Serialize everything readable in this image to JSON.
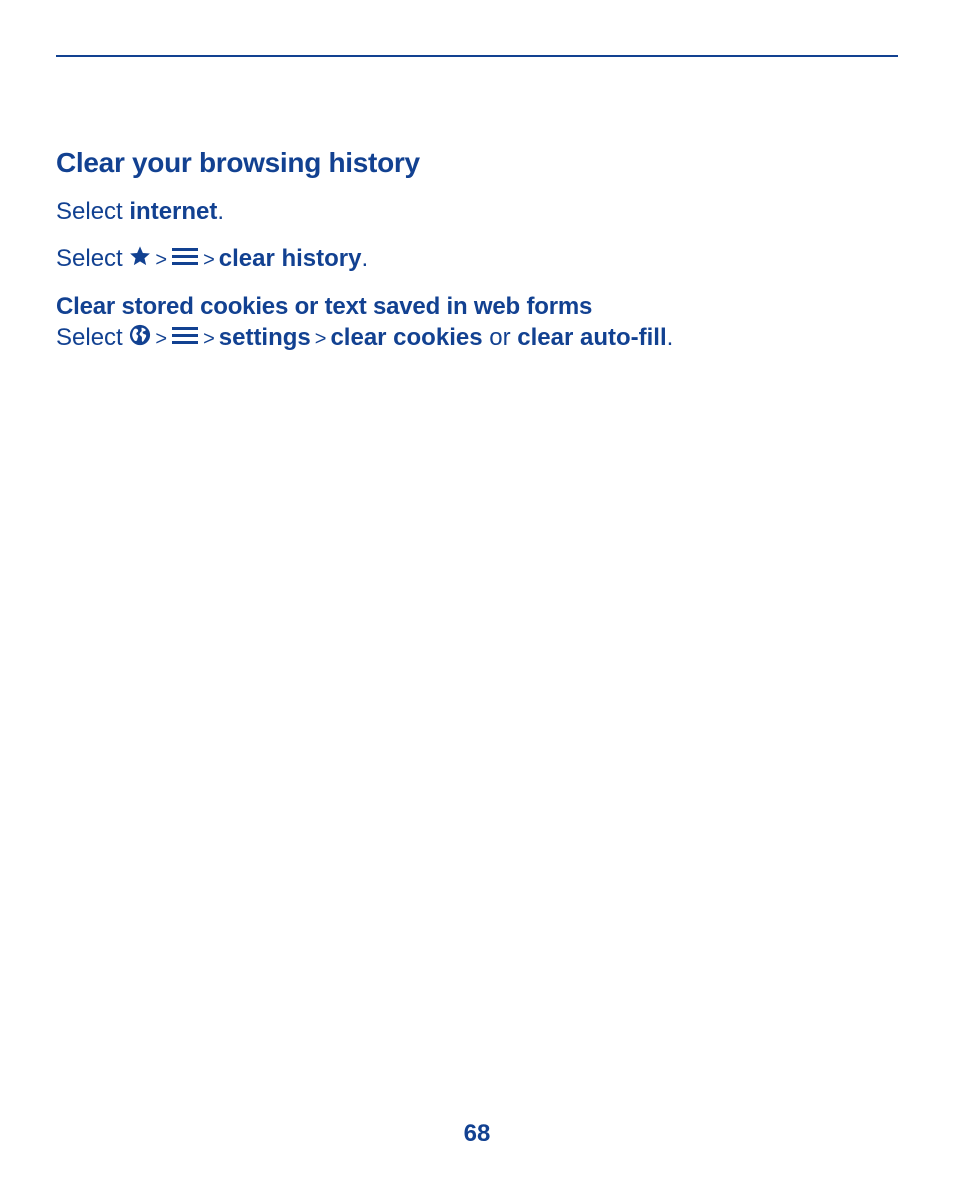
{
  "page": {
    "heading": "Clear your browsing history",
    "step1": {
      "prefix": "Select ",
      "target": "internet",
      "suffix": "."
    },
    "step2": {
      "prefix": "Select ",
      "icons": [
        "star-icon",
        "menu-icon"
      ],
      "separator": ">",
      "target": "clear history",
      "suffix": "."
    },
    "subheading": "Clear stored cookies or text saved in web forms",
    "step3": {
      "prefix": "Select ",
      "icons": [
        "globe-icon",
        "menu-icon"
      ],
      "separator": ">",
      "item1": "settings",
      "item2": "clear cookies",
      "conjunction": " or ",
      "item3": "clear auto-fill",
      "suffix": "."
    },
    "page_number": "68",
    "accent_color": "#124191"
  }
}
